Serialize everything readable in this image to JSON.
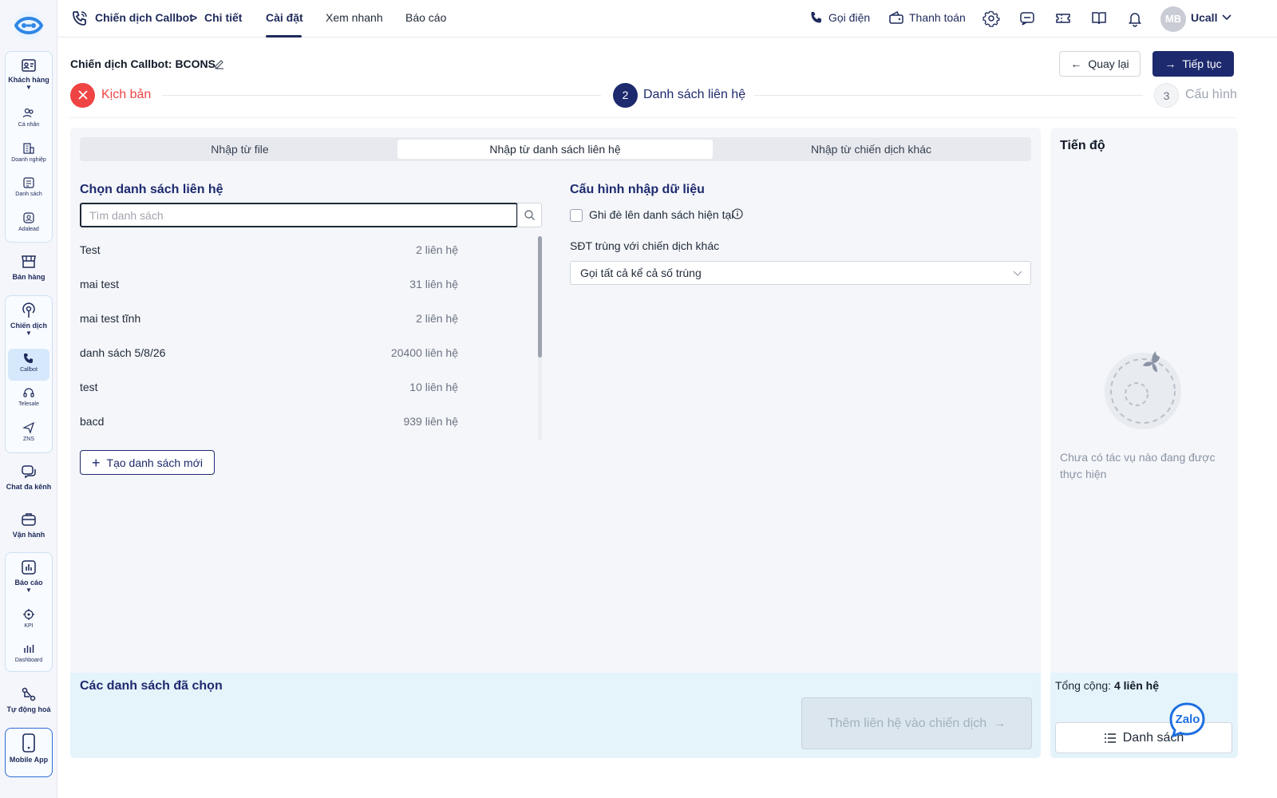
{
  "sidebar": {
    "groups": [
      {
        "label": "Khách hàng",
        "sub": [
          {
            "label": "Cá nhân"
          },
          {
            "label": "Doanh nghiệp"
          },
          {
            "label": "Danh sách"
          },
          {
            "label": "Adalead"
          }
        ]
      },
      {
        "label": "Bán hàng"
      },
      {
        "label": "Chiến dịch",
        "sub": [
          {
            "label": "Callbot"
          },
          {
            "label": "Telesale"
          },
          {
            "label": "ZNS"
          }
        ]
      },
      {
        "label": "Chat đa kênh"
      },
      {
        "label": "Vận hành"
      },
      {
        "label": "Báo cáo",
        "sub": [
          {
            "label": "KPI"
          },
          {
            "label": "Dashboard"
          }
        ]
      },
      {
        "label": "Tự động hoá"
      },
      {
        "label": "Mobile App"
      }
    ]
  },
  "topbar": {
    "breadcrumb": {
      "root": "Chiến dịch Callbot",
      "sep": ">",
      "current": "Chi tiết"
    },
    "tabs": [
      {
        "label": "Cài đặt"
      },
      {
        "label": "Xem nhanh"
      },
      {
        "label": "Báo cáo"
      }
    ],
    "call_label": "Gọi điện",
    "payment_label": "Thanh toán",
    "avatar_initials": "MB",
    "user_name": "Ucall"
  },
  "header": {
    "title": "Chiến dịch Callbot: BCONS",
    "back_label": "Quay lại",
    "next_label": "Tiếp tục"
  },
  "steps": [
    {
      "number": "",
      "label": "Kịch bản",
      "state": "error"
    },
    {
      "number": "2",
      "label": "Danh sách liên hệ",
      "state": "active"
    },
    {
      "number": "3",
      "label": "Cấu hình",
      "state": "pending"
    }
  ],
  "import_tabs": [
    {
      "label": "Nhập từ file"
    },
    {
      "label": "Nhập từ danh sách liên hệ"
    },
    {
      "label": "Nhập từ chiến dịch khác"
    }
  ],
  "contact_lists": {
    "title": "Chọn danh sách liên hệ",
    "search_placeholder": "Tìm danh sách",
    "items": [
      {
        "name": "Test",
        "count": "2 liên hệ"
      },
      {
        "name": "mai test",
        "count": "31 liên hệ"
      },
      {
        "name": "mai test tĩnh",
        "count": "2 liên hệ"
      },
      {
        "name": "danh sách 5/8/26",
        "count": "20400 liên hệ"
      },
      {
        "name": "test",
        "count": "10 liên hệ"
      },
      {
        "name": "bacd",
        "count": "939 liên hệ"
      }
    ],
    "new_button": "Tạo danh sách mới"
  },
  "config": {
    "title": "Cấu hình nhập dữ liệu",
    "overwrite_label": "Ghi đè lên danh sách hiện tại",
    "overwrite_checked": false,
    "dup_label": "SĐT trùng với chiến dịch khác",
    "dup_value": "Gọi tất cả kể cả số trùng"
  },
  "selected": {
    "title": "Các danh sách đã chọn",
    "add_button": "Thêm liên hệ vào chiến dịch"
  },
  "progress": {
    "title": "Tiến độ",
    "empty_text": "Chưa có tác vụ nào đang được thực hiện",
    "total_label": "Tổng cộng:",
    "total_value": "4 liên hệ",
    "list_button": "Danh sách",
    "zalo_label": "Zalo"
  },
  "colors": {
    "primary": "#1e2a6e",
    "error": "#ef4444",
    "panel": "#f4f6fa",
    "selected_bg": "#e5f3fb"
  }
}
